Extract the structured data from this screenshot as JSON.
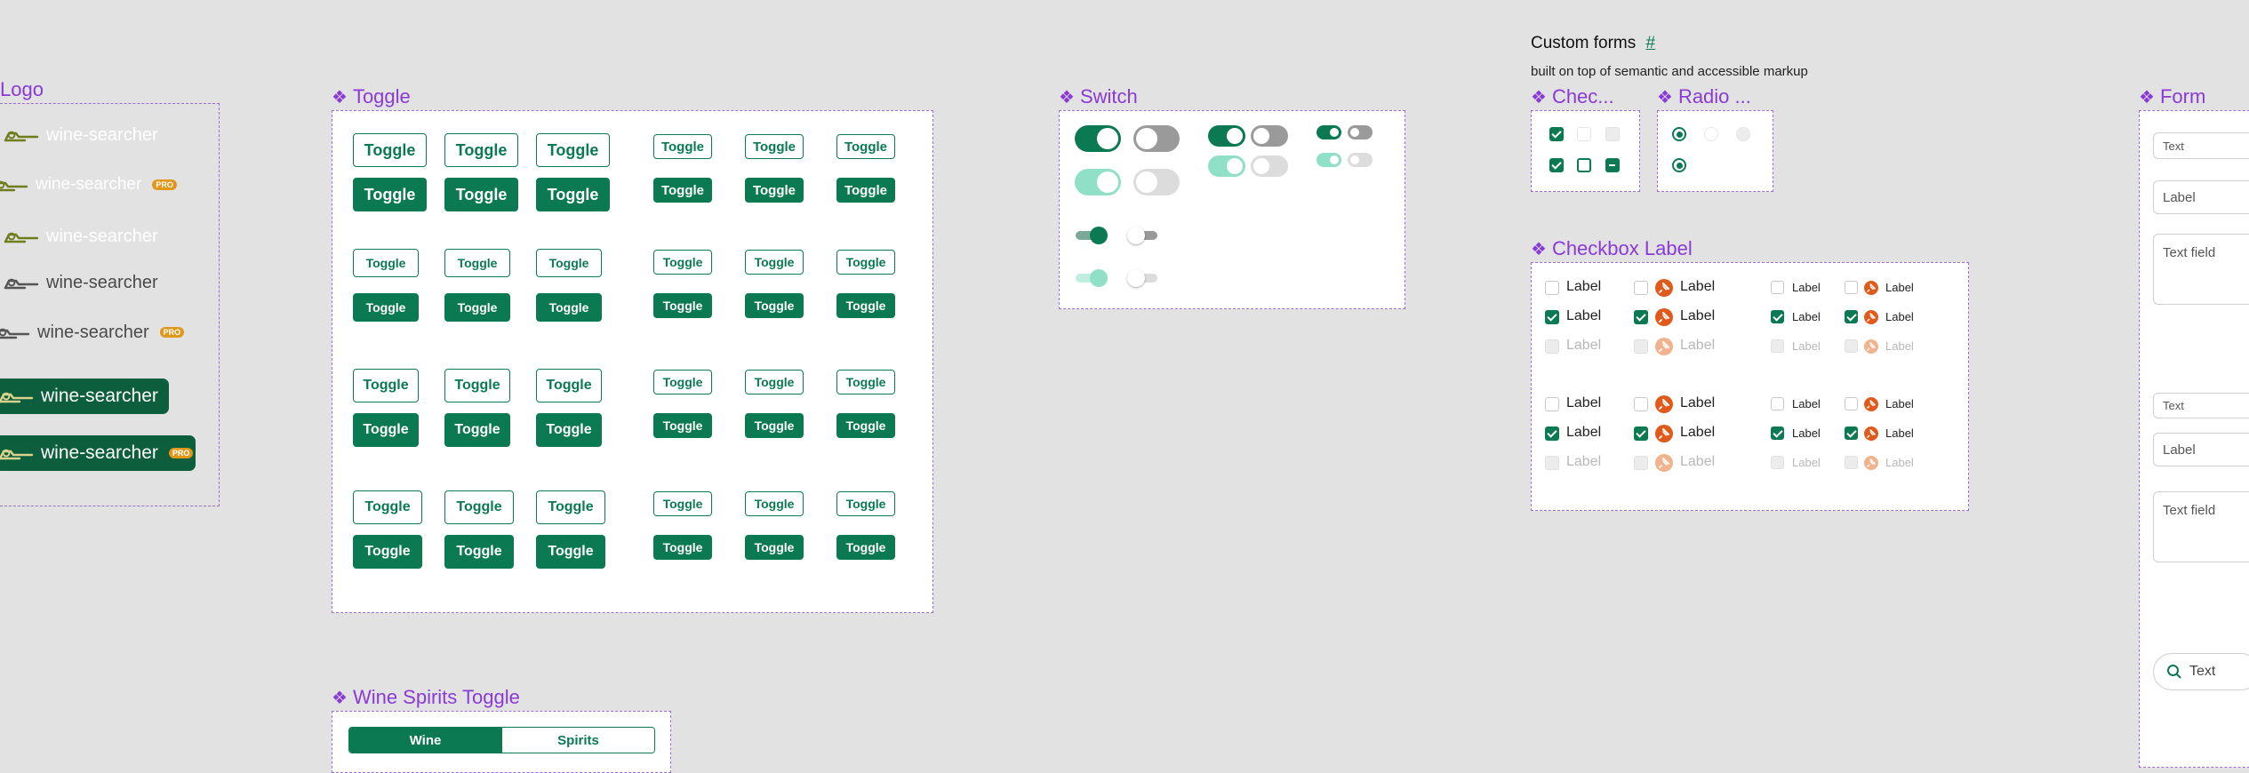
{
  "header": {
    "title": "Custom forms",
    "hash": "#",
    "subtitle": "built on top of semantic and accessible markup"
  },
  "sections": {
    "logo": "Logo",
    "toggle": "Toggle",
    "switch": "Switch",
    "checkbox": "Chec...",
    "radio": "Radio ...",
    "checkbox_label": "Checkbox Label",
    "form": "Form",
    "wine_spirits": "Wine Spirits Toggle"
  },
  "logo": {
    "brand": "wine-searcher",
    "pro_badge": "PRO"
  },
  "toggle": {
    "label": "Toggle"
  },
  "checkbox_label": {
    "label": "Label"
  },
  "form": {
    "text_label": "Text",
    "label": "Label",
    "text_field": "Text field",
    "search": "Text"
  },
  "wine_spirits": {
    "wine": "Wine",
    "spirits": "Spirits"
  },
  "icons": {
    "section": "component-diamond-icon",
    "logo": "wine-searcher-logo-icon",
    "pin": "pin-icon",
    "search": "search-icon"
  },
  "colors": {
    "brand_green": "#0b7a52",
    "dark_green": "#0d5e3c",
    "mint": "#8fe0c6",
    "section_purple": "#8a3ad6",
    "pro_orange": "#e1971a",
    "pin_orange": "#e05a1c"
  }
}
